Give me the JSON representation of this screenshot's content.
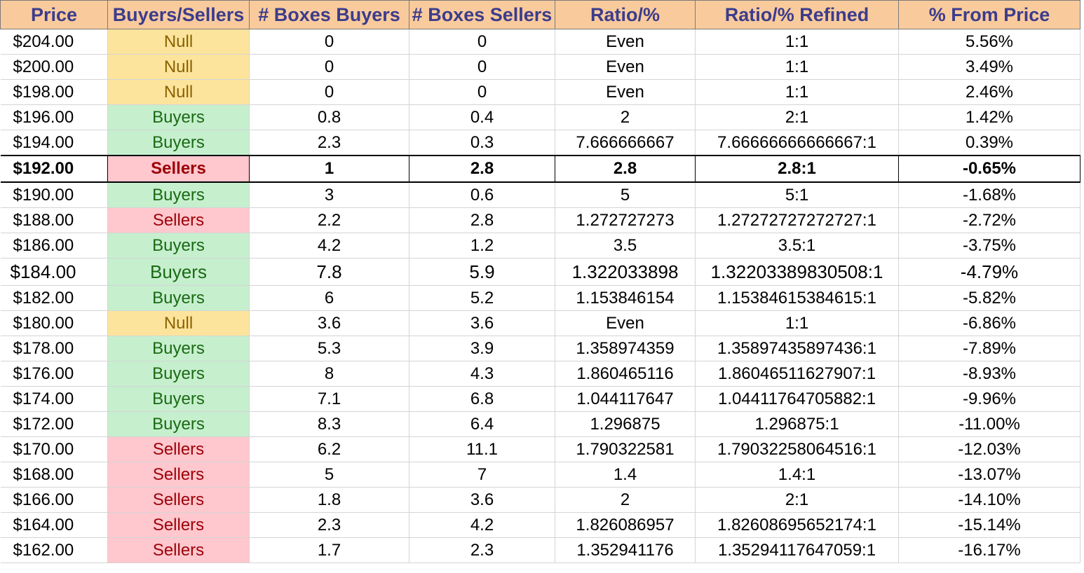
{
  "headers": [
    "Price",
    "Buyers/Sellers",
    "# Boxes Buyers",
    "# Boxes Sellers",
    "Ratio/%",
    "Ratio/% Refined",
    "% From Price"
  ],
  "colors": {
    "header_bg": "#f9cb9c",
    "header_text": "#3c3c8c",
    "null_bg": "#fde49c",
    "null_text": "#8a6200",
    "buyers_bg": "#c6efce",
    "buyers_text": "#1a6a14",
    "sellers_bg": "#ffc7ce",
    "sellers_text": "#9c0006"
  },
  "rows": [
    [
      "$204.00",
      "Null",
      "0",
      "0",
      "Even",
      "1:1",
      "5.56%"
    ],
    [
      "$200.00",
      "Null",
      "0",
      "0",
      "Even",
      "1:1",
      "3.49%"
    ],
    [
      "$198.00",
      "Null",
      "0",
      "0",
      "Even",
      "1:1",
      "2.46%"
    ],
    [
      "$196.00",
      "Buyers",
      "0.8",
      "0.4",
      "2",
      "2:1",
      "1.42%"
    ],
    [
      "$194.00",
      "Buyers",
      "2.3",
      "0.3",
      "7.666666667",
      "7.66666666666667:1",
      "0.39%"
    ],
    [
      "$192.00",
      "Sellers",
      "1",
      "2.8",
      "2.8",
      "2.8:1",
      "-0.65%"
    ],
    [
      "$190.00",
      "Buyers",
      "3",
      "0.6",
      "5",
      "5:1",
      "-1.68%"
    ],
    [
      "$188.00",
      "Sellers",
      "2.2",
      "2.8",
      "1.272727273",
      "1.27272727272727:1",
      "-2.72%"
    ],
    [
      "$186.00",
      "Buyers",
      "4.2",
      "1.2",
      "3.5",
      "3.5:1",
      "-3.75%"
    ],
    [
      "$184.00",
      "Buyers",
      "7.8",
      "5.9",
      "1.322033898",
      "1.32203389830508:1",
      "-4.79%"
    ],
    [
      "$182.00",
      "Buyers",
      "6",
      "5.2",
      "1.153846154",
      "1.15384615384615:1",
      "-5.82%"
    ],
    [
      "$180.00",
      "Null",
      "3.6",
      "3.6",
      "Even",
      "1:1",
      "-6.86%"
    ],
    [
      "$178.00",
      "Buyers",
      "5.3",
      "3.9",
      "1.358974359",
      "1.35897435897436:1",
      "-7.89%"
    ],
    [
      "$176.00",
      "Buyers",
      "8",
      "4.3",
      "1.860465116",
      "1.86046511627907:1",
      "-8.93%"
    ],
    [
      "$174.00",
      "Buyers",
      "7.1",
      "6.8",
      "1.044117647",
      "1.04411764705882:1",
      "-9.96%"
    ],
    [
      "$172.00",
      "Buyers",
      "8.3",
      "6.4",
      "1.296875",
      "1.296875:1",
      "-11.00%"
    ],
    [
      "$170.00",
      "Sellers",
      "6.2",
      "11.1",
      "1.790322581",
      "1.79032258064516:1",
      "-12.03%"
    ],
    [
      "$168.00",
      "Sellers",
      "5",
      "7",
      "1.4",
      "1.4:1",
      "-13.07%"
    ],
    [
      "$166.00",
      "Sellers",
      "1.8",
      "3.6",
      "2",
      "2:1",
      "-14.10%"
    ],
    [
      "$164.00",
      "Sellers",
      "2.3",
      "4.2",
      "1.826086957",
      "1.82608695652174:1",
      "-15.14%"
    ],
    [
      "$162.00",
      "Sellers",
      "1.7",
      "2.3",
      "1.352941176",
      "1.35294117647059:1",
      "-16.17%"
    ]
  ]
}
